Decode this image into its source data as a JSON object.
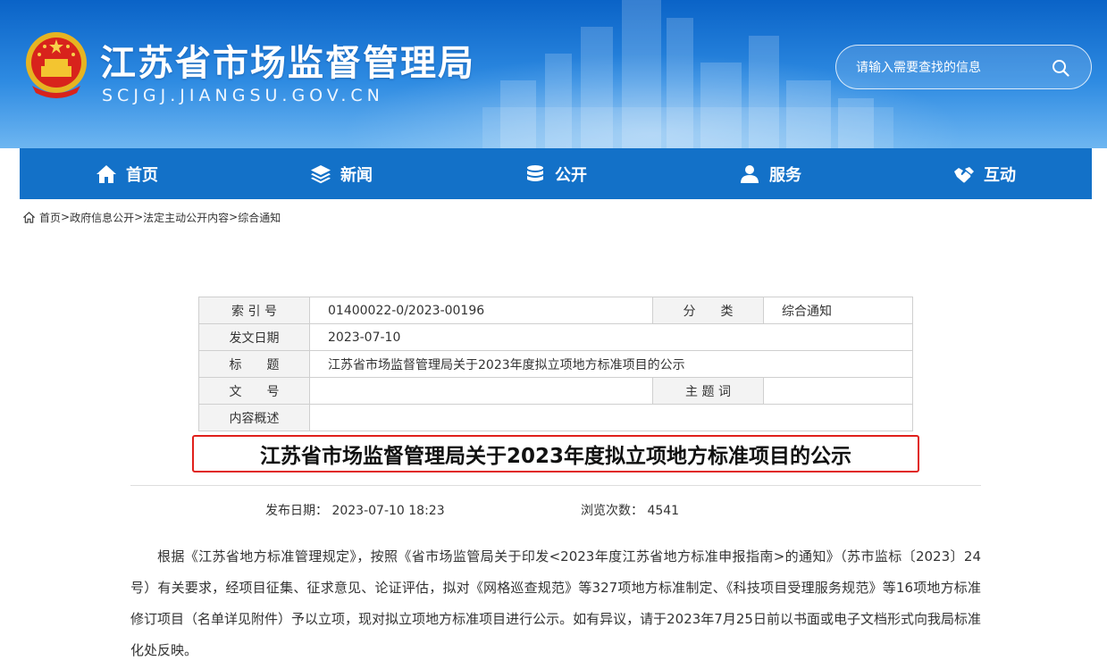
{
  "header": {
    "site_title": "江苏省市场监督管理局",
    "site_domain": "SCJGJ.JIANGSU.GOV.CN",
    "search_placeholder": "请输入需要查找的信息",
    "emblem_icon": "national-emblem-icon"
  },
  "nav": {
    "items": [
      {
        "label": "首页",
        "icon": "home-icon"
      },
      {
        "label": "新闻",
        "icon": "layers-icon"
      },
      {
        "label": "公开",
        "icon": "database-icon"
      },
      {
        "label": "服务",
        "icon": "user-group-icon"
      },
      {
        "label": "互动",
        "icon": "handshake-icon"
      }
    ]
  },
  "breadcrumb": {
    "items": [
      "首页",
      "政府信息公开",
      "法定主动公开内容",
      "综合通知"
    ],
    "separator": ">"
  },
  "info_table": {
    "index_label": "索 引 号",
    "index_value": "01400022-0/2023-00196",
    "category_label": "分　　类",
    "category_value": "综合通知",
    "date_label": "发文日期",
    "date_value": "2023-07-10",
    "title_label": "标　　题",
    "title_value": "江苏省市场监督管理局关于2023年度拟立项地方标准项目的公示",
    "doc_no_label": "文　　号",
    "doc_no_value": "",
    "keyword_label": "主 题 词",
    "keyword_value": "",
    "summary_label": "内容概述",
    "summary_value": ""
  },
  "article": {
    "title": "江苏省市场监督管理局关于2023年度拟立项地方标准项目的公示",
    "publish_date": "发布日期： 2023-07-10 18:23",
    "views": "浏览次数： 4541",
    "body": "根据《江苏省地方标准管理规定》，按照《省市场监管局关于印发<2023年度江苏省地方标准申报指南>的通知》（苏市监标〔2023〕24号）有关要求，经项目征集、征求意见、论证评估，拟对《网格巡查规范》等327项地方标准制定、《科技项目受理服务规范》等16项地方标准修订项目（名单详见附件）予以立项，现对拟立项地方标准项目进行公示。如有异议，请于2023年7月25日前以书面或电子文档形式向我局标准化处反映。"
  },
  "colors": {
    "nav_bg": "#1371c8",
    "title_border": "#e0201b",
    "banner_top": "#0a63c7"
  }
}
